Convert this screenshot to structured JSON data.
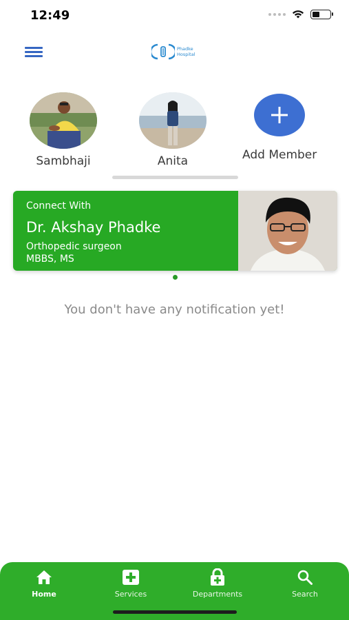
{
  "status_bar": {
    "time": "12:49"
  },
  "header": {
    "logo_text_line1": "Phadke",
    "logo_text_line2": "Hospital"
  },
  "members": [
    {
      "name": "Sambhaji"
    },
    {
      "name": "Anita"
    },
    {
      "name": "Add Member",
      "icon": "plus-icon"
    }
  ],
  "doctor_card": {
    "connect_label": "Connect With",
    "name": "Dr. Akshay Phadke",
    "title": "Orthopedic surgeon",
    "degree": "MBBS, MS",
    "background_color": "#27a924"
  },
  "notifications": {
    "empty_message": "You don't have any notification yet!"
  },
  "tab_bar": {
    "color": "#2fad2a",
    "tabs": [
      {
        "label": "Home",
        "icon": "home-icon",
        "active": true
      },
      {
        "label": "Services",
        "icon": "medical-plus-icon",
        "active": false
      },
      {
        "label": "Departments",
        "icon": "medical-lock-icon",
        "active": false
      },
      {
        "label": "Search",
        "icon": "search-icon",
        "active": false
      }
    ]
  }
}
